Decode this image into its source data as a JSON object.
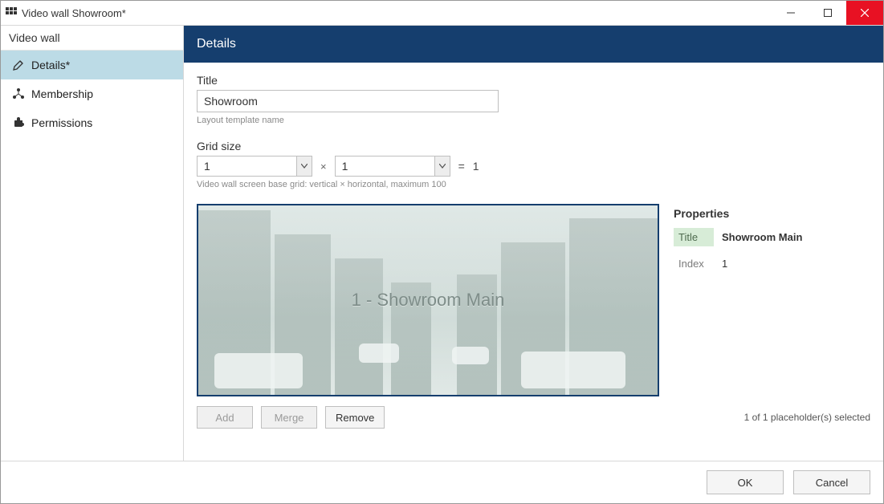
{
  "window": {
    "title": "Video wall Showroom*"
  },
  "sidebar": {
    "header": "Video wall",
    "items": [
      {
        "label": "Details*",
        "icon": "pencil-icon",
        "active": true
      },
      {
        "label": "Membership",
        "icon": "nodes-icon",
        "active": false
      },
      {
        "label": "Permissions",
        "icon": "puzzle-icon",
        "active": false
      }
    ]
  },
  "panel": {
    "header": "Details",
    "title_field": {
      "label": "Title",
      "value": "Showroom",
      "helper": "Layout template name"
    },
    "grid_size": {
      "label": "Grid size",
      "vertical": "1",
      "horizontal": "1",
      "equals_prefix": "=",
      "result": "1",
      "times": "×",
      "helper": "Video wall screen base grid: vertical × horizontal, maximum 100"
    },
    "preview": {
      "cell_label": "1 - Showroom Main"
    },
    "properties": {
      "heading": "Properties",
      "rows": [
        {
          "label": "Title",
          "value": "Showroom Main"
        },
        {
          "label": "Index",
          "value": "1"
        }
      ]
    },
    "toolbar": {
      "add": "Add",
      "merge": "Merge",
      "remove": "Remove",
      "status": "1 of 1 placeholder(s) selected"
    }
  },
  "footer": {
    "ok": "OK",
    "cancel": "Cancel"
  }
}
